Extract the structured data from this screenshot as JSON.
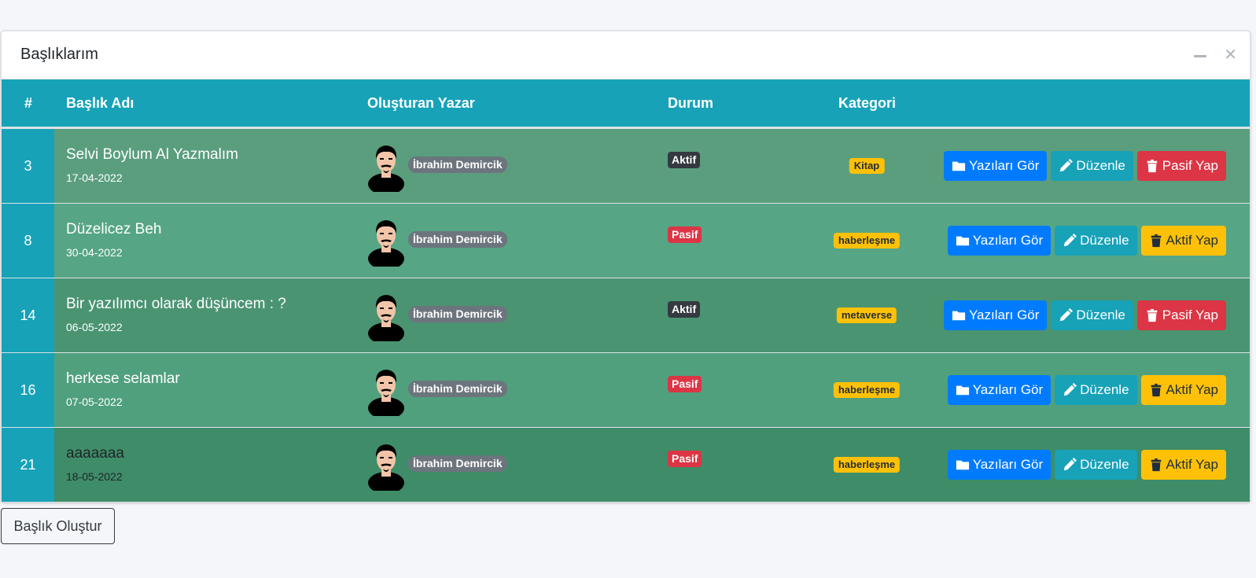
{
  "card": {
    "title": "Başlıklarım"
  },
  "table": {
    "headers": [
      "#",
      "Başlık Adı",
      "Oluşturan Yazar",
      "Durum",
      "Kategori"
    ],
    "rows": [
      {
        "num": "3",
        "title": "Selvi Boylum Al Yazmalım",
        "date": "17-04-2022",
        "author": "İbrahim Demircik",
        "status": "Aktif",
        "category": "Kitap",
        "btn_view": "Yazıları Gör",
        "btn_edit": "Düzenle",
        "btn_toggle": "Pasif Yap"
      },
      {
        "num": "8",
        "title": "Düzelicez Beh",
        "date": "30-04-2022",
        "author": "İbrahim Demircik",
        "status": "Pasif",
        "category": "haberleşme",
        "btn_view": "Yazıları Gör",
        "btn_edit": "Düzenle",
        "btn_toggle": "Aktif Yap"
      },
      {
        "num": "14",
        "title": "Bir yazılımcı olarak düşüncem : ?",
        "date": "06-05-2022",
        "author": "İbrahim Demircik",
        "status": "Aktif",
        "category": "metaverse",
        "btn_view": "Yazıları Gör",
        "btn_edit": "Düzenle",
        "btn_toggle": "Pasif Yap"
      },
      {
        "num": "16",
        "title": "herkese selamlar",
        "date": "07-05-2022",
        "author": "İbrahim Demircik",
        "status": "Pasif",
        "category": "haberleşme",
        "btn_view": "Yazıları Gör",
        "btn_edit": "Düzenle",
        "btn_toggle": "Aktif Yap"
      },
      {
        "num": "21",
        "title": "aaaaaaa",
        "date": "18-05-2022",
        "author": "İbrahim Demircik",
        "status": "Pasif",
        "category": "haberleşme",
        "btn_view": "Yazıları Gör",
        "btn_edit": "Düzenle",
        "btn_toggle": "Aktif Yap"
      }
    ]
  },
  "footer": {
    "create_button": "Başlık Oluştur"
  },
  "colors": {
    "header_teal": "#17a2b8",
    "primary": "#007bff",
    "danger": "#dc3545",
    "warning": "#ffc107",
    "dark": "#343a40",
    "row_backgrounds": [
      "#5a9e7e",
      "#56a584",
      "#4a9472",
      "#50a07e",
      "#3e8d68"
    ]
  },
  "icons": {
    "view": "folder-icon",
    "edit": "pencil-icon",
    "toggle": "trash-icon",
    "minimize": "minus-icon",
    "close": "close-icon"
  }
}
